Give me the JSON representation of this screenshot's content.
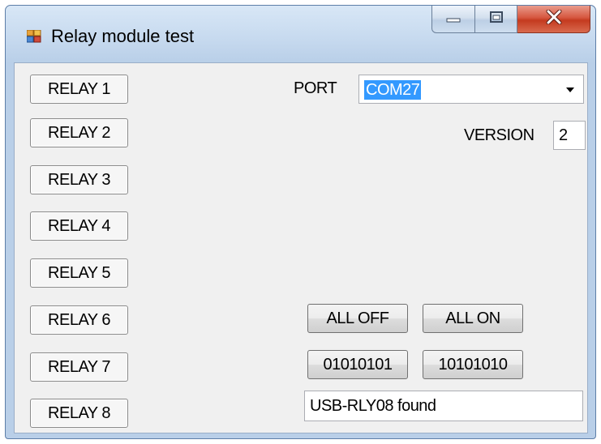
{
  "window": {
    "title": "Relay module test"
  },
  "relays": [
    {
      "label": "RELAY 1"
    },
    {
      "label": "RELAY 2"
    },
    {
      "label": "RELAY 3"
    },
    {
      "label": "RELAY 4"
    },
    {
      "label": "RELAY 5"
    },
    {
      "label": "RELAY 6"
    },
    {
      "label": "RELAY 7"
    },
    {
      "label": "RELAY 8"
    }
  ],
  "port": {
    "label": "PORT",
    "selected": "COM27"
  },
  "version": {
    "label": "VERSION",
    "value": "2"
  },
  "actions": {
    "all_off": "ALL OFF",
    "all_on": "ALL ON",
    "pattern_a": "01010101",
    "pattern_b": "10101010"
  },
  "status": {
    "text": "USB-RLY08 found"
  },
  "icons": {
    "app": "app-icon",
    "minimize": "minimize-icon",
    "maximize": "maximize-icon",
    "close": "close-icon",
    "dropdown": "chevron-down-icon"
  },
  "colors": {
    "selection": "#3399ff",
    "close_button": "#c43a1f",
    "client_background": "#f0f0f0"
  }
}
